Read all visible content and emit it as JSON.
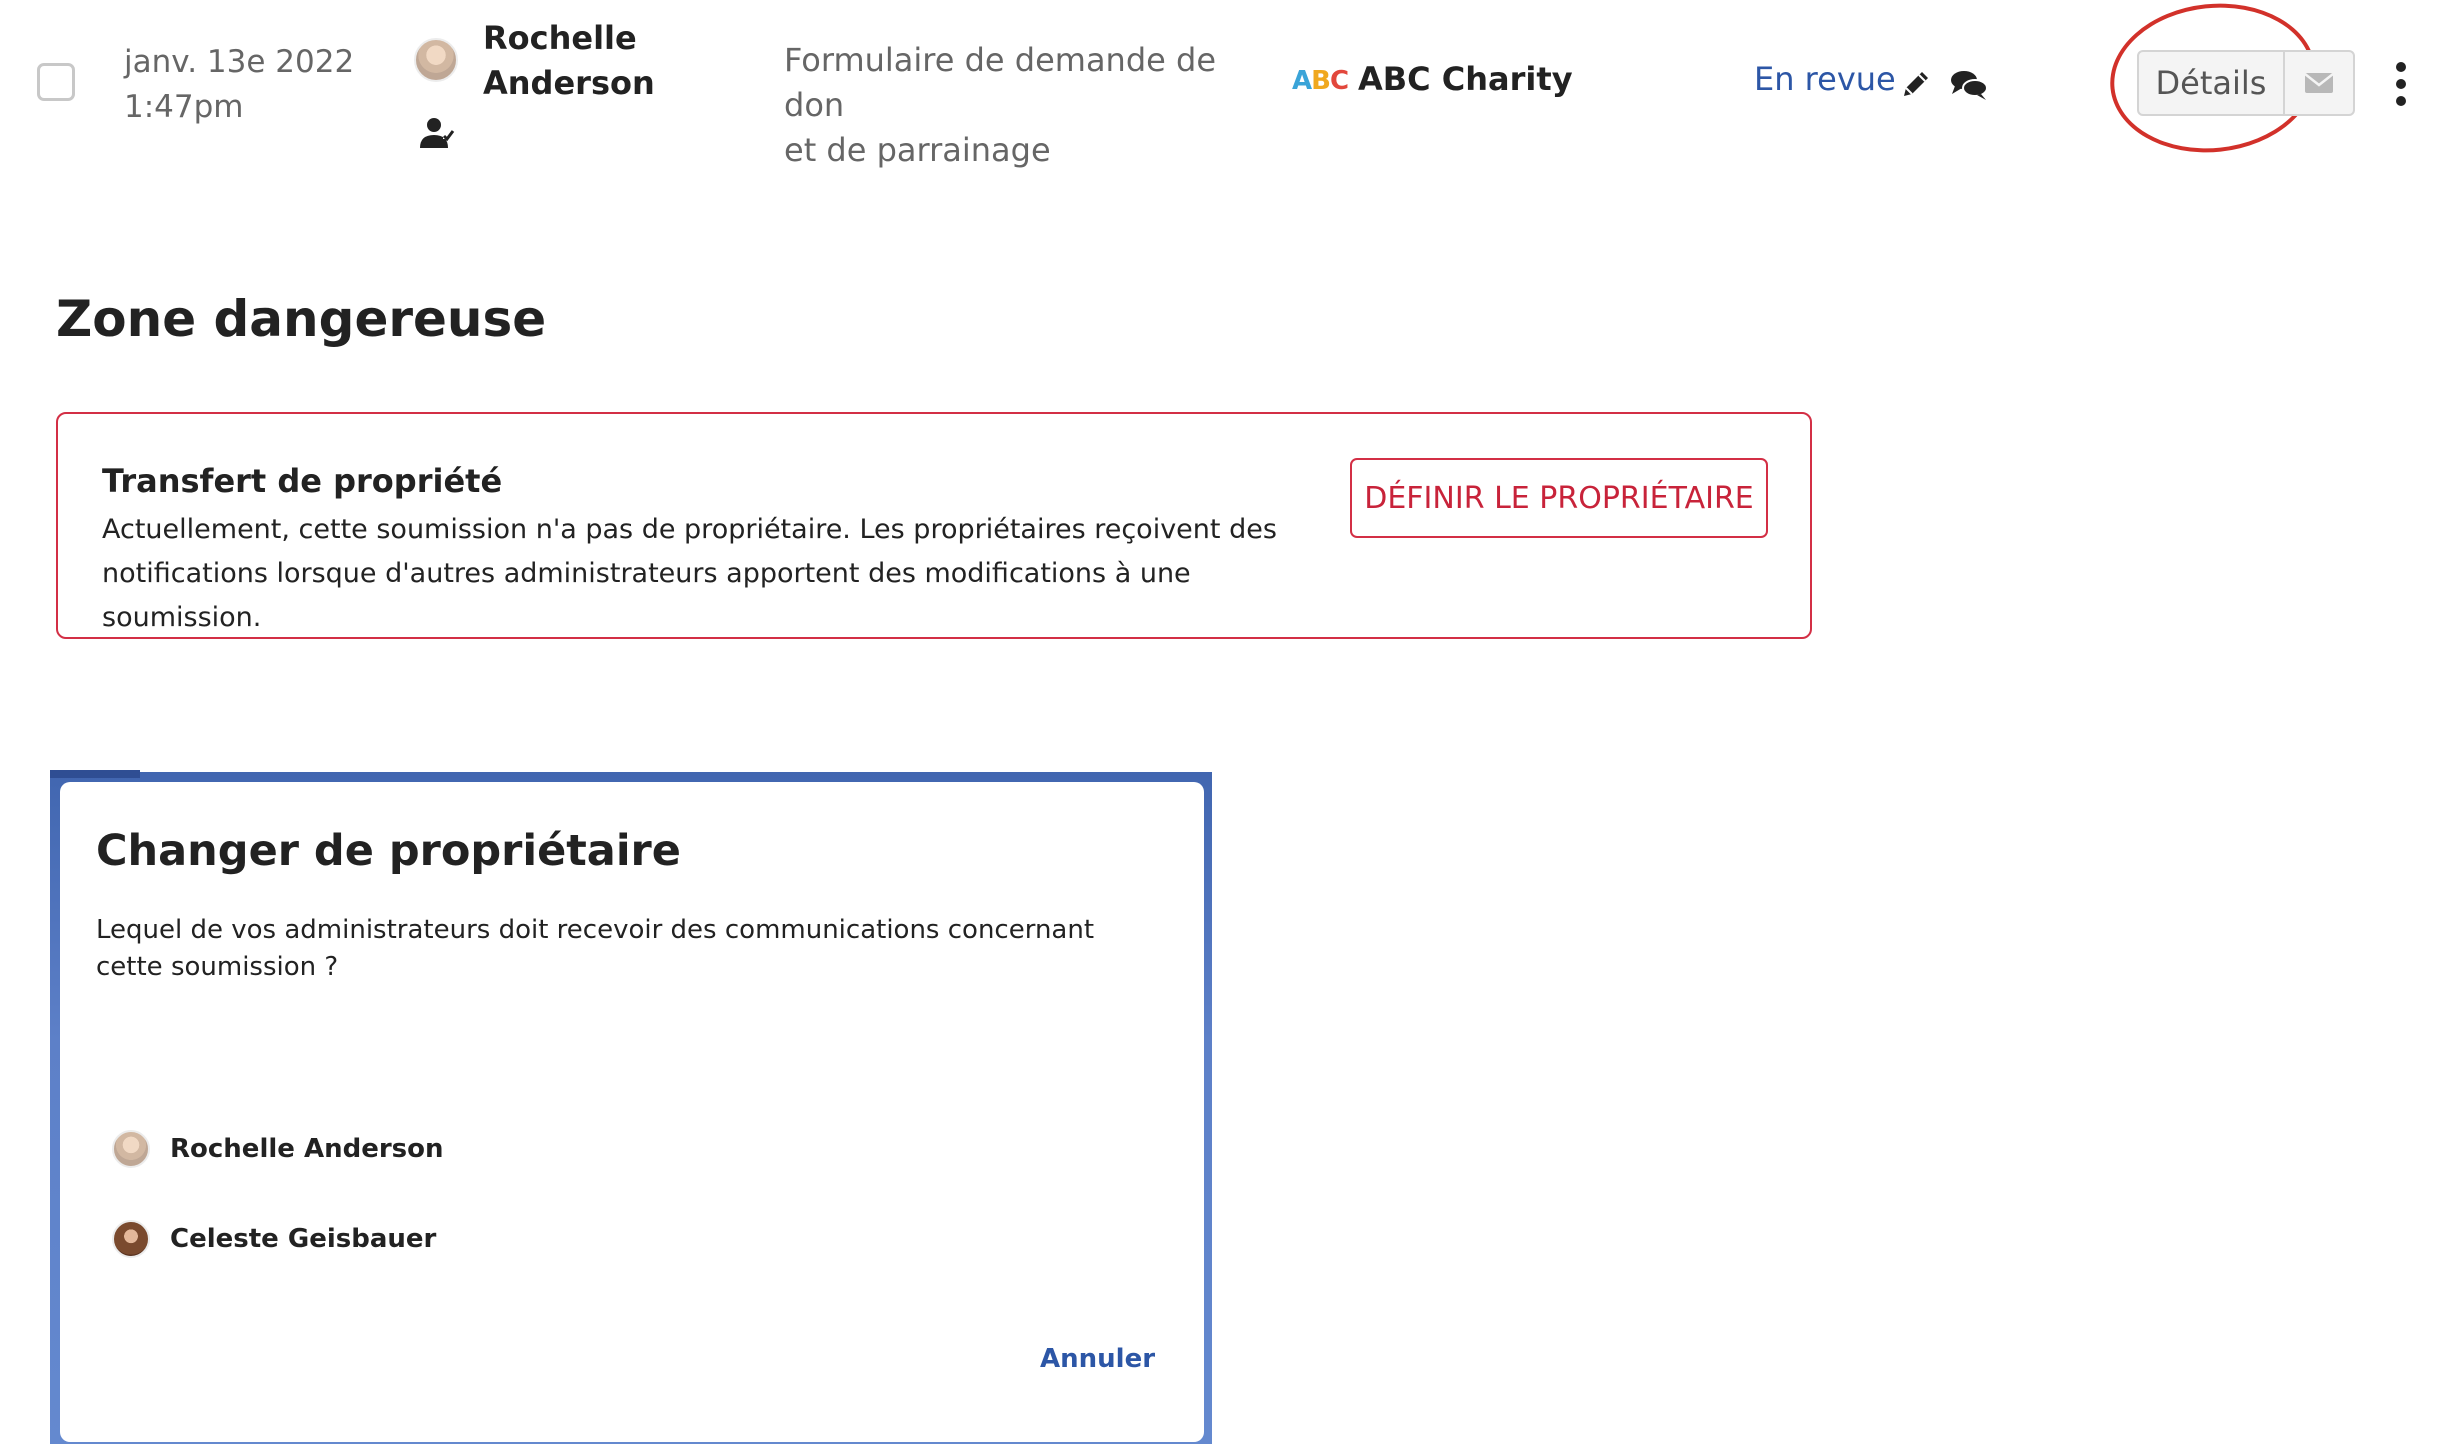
{
  "submission_row": {
    "date_line1": "janv. 13e 2022",
    "date_line2": "1:47pm",
    "applicant_first": "Rochelle",
    "applicant_last": "Anderson",
    "form_line1": "Formulaire de demande de don",
    "form_line2": "et de parrainage",
    "org_logo_letters": [
      "A",
      "B",
      "C"
    ],
    "org_name": "ABC Charity",
    "status": "En revue",
    "details_label": "Détails",
    "icons": [
      "checkbox",
      "avatar",
      "owner-user-icon",
      "pencil-icon",
      "comments-icon",
      "envelope-icon",
      "kebab-menu-icon"
    ],
    "highlight_color": "#d2312a"
  },
  "danger_zone": {
    "title": "Zone dangereuse",
    "card_title": "Transfert de propriété",
    "card_description": "Actuellement, cette soumission n'a pas de propriétaire. Les propriétaires reçoivent des notifications lorsque d'autres administrateurs apportent des modifications à une soumission.",
    "button_label": "DÉFINIR LE PROPRIÉTAIRE",
    "accent_color": "#d32f45"
  },
  "modal": {
    "title": "Changer de propriétaire",
    "question": "Lequel de vos administrateurs doit recevoir des communications concernant cette soumission ?",
    "options": [
      {
        "name": "Rochelle Anderson"
      },
      {
        "name": "Celeste Geisbauer"
      }
    ],
    "cancel_label": "Annuler",
    "link_color": "#2c56a6"
  }
}
